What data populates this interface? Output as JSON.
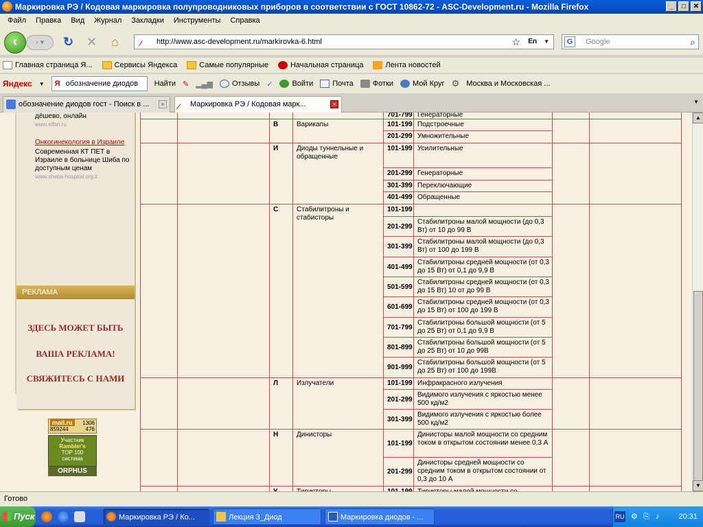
{
  "window": {
    "title": "Маркировка РЭ / Кодовая маркировка полупроводниковых приборов в соответствии с ГОСТ 10862-72 - ASC-Development.ru - Mozilla Firefox"
  },
  "menu": [
    "Файл",
    "Правка",
    "Вид",
    "Журнал",
    "Закладки",
    "Инструменты",
    "Справка"
  ],
  "address": {
    "url": "http://www.asc-development.ru/markirovka-6.html",
    "lang": "En"
  },
  "search": {
    "placeholder": "Google"
  },
  "bookmarks": [
    "Главная страница Я...",
    "Сервисы Яндекса",
    "Самые популярные",
    "Начальная страница",
    "Лента новостей"
  ],
  "yandex_bar": {
    "logo": "Яндекс",
    "query": "обозначение диодов",
    "find": "Найти",
    "reviews": "Отзывы",
    "login": "Войти",
    "mail": "Почта",
    "photos": "Фотки",
    "mycircle": "Мой Круг",
    "region": "Москва и Московская ..."
  },
  "tabs": [
    {
      "label": "обозначение диодов гост - Поиск в ...",
      "active": false
    },
    {
      "label": "Маркировка РЭ / Кодовая марк...",
      "active": true
    }
  ],
  "sidebar": {
    "ad1_line1": "дёшево, онлайн",
    "ad1_src": "www.elfan.ru",
    "ad2_link": "Онкогинекология в Израиле",
    "ad2_text": "Современная КТ ПЕТ в Израиле в больнице Шиба по доступным ценам",
    "ad2_src": "www.sheba-hospital.org.il",
    "ad_header": "РЕКЛАМА",
    "ad_line1": "ЗДЕСЬ МОЖЕТ БЫТЬ",
    "ad_line2": "ВАША РЕКЛАМА!",
    "ad_line3": "СВЯЖИТЕСЬ С НАМИ",
    "counter_mail": "mail.ru",
    "counter_n1": "1306",
    "counter_n2": "859244",
    "counter_n3": "476",
    "rambler_1": "Участник",
    "rambler_2": "Rambler's",
    "rambler_3": "TOP 100",
    "rambler_4": "система",
    "orphus": "ORPHUS"
  },
  "table": {
    "rows": [
      {
        "code": "",
        "type": "",
        "range": "701-799",
        "desc": "Генераторные"
      },
      {
        "code": "В",
        "type": "Варикапы",
        "range": "101-199",
        "desc": "Подстроечные"
      },
      {
        "code": "",
        "type": "",
        "range": "201-299",
        "desc": "Умножительные"
      },
      {
        "code": "И",
        "type": "Диоды туннельные и обращенные",
        "range": "101-199",
        "desc": "Усилительные"
      },
      {
        "code": "",
        "type": "",
        "range": "201-299",
        "desc": "Генераторные"
      },
      {
        "code": "",
        "type": "",
        "range": "301-399",
        "desc": "Переключающие"
      },
      {
        "code": "",
        "type": "",
        "range": "401-499",
        "desc": "Обращенные"
      },
      {
        "code": "С",
        "type": "Стабилитроны и стабисторы",
        "range": "101-199",
        "desc": ""
      },
      {
        "code": "",
        "type": "",
        "range": "201-299",
        "desc": "Стабилитроны малой мощности (до 0,3 Вт) от 10 до 99 В"
      },
      {
        "code": "",
        "type": "",
        "range": "301-399",
        "desc": "Стабилитроны малой мощности (до 0,3 Вт) от 100 до 199 В"
      },
      {
        "code": "",
        "type": "",
        "range": "401-499",
        "desc": "Стабилитроны средней мощности (от 0,3 до 15 Вт) от 0,1 до 9,9 В"
      },
      {
        "code": "",
        "type": "",
        "range": "501-599",
        "desc": "Стабилитроны средней мощности (от 0,3 до 15 Вт) 10 от до 99 В"
      },
      {
        "code": "",
        "type": "",
        "range": "601-699",
        "desc": "Стабилитроны средней мощности (от 0,3 до 15 Вт) от 100 до 199 В"
      },
      {
        "code": "",
        "type": "",
        "range": "701-799",
        "desc": "Стабилитроны большой мощности (от 5 до 25 Вт) от 0,1 до 9,9 В"
      },
      {
        "code": "",
        "type": "",
        "range": "801-899",
        "desc": "Стабилитроны большой мощности (от 5 до 25 Вт) от 10 до 99В"
      },
      {
        "code": "",
        "type": "",
        "range": "901-999",
        "desc": "Стабилитроны большой мощности (от 5 до 25 Вт) от 100 до 199В"
      },
      {
        "code": "Л",
        "type": "Излучатели",
        "range": "101-199",
        "desc": "Инфракрасного излучения"
      },
      {
        "code": "",
        "type": "",
        "range": "201-299",
        "desc": "Видимого излучения с яркостью менее 500 кд/м2"
      },
      {
        "code": "",
        "type": "",
        "range": "301-399",
        "desc": "Видимого излучения с яркостью более 500 кд/м2"
      },
      {
        "code": "Н",
        "type": "Динисторы",
        "range": "101-199",
        "desc": "Динисторы малой мощности со средним током в открытом состоянии менее 0,3 А"
      },
      {
        "code": "",
        "type": "",
        "range": "201-299",
        "desc": "Динисторы средней мощности со средним током в открытом состоянии от 0,3 до 10 А"
      },
      {
        "code": "У",
        "type": "Тиристоры",
        "range": "101-199",
        "desc": "Тиристоры малой мощности со"
      }
    ]
  },
  "status": "Готово",
  "taskbar": {
    "start": "Пуск",
    "tasks": [
      "Маркировка РЭ / Ко...",
      "Лекция 3_Диод",
      "Маркировка диодов - ..."
    ],
    "lang": "RU",
    "clock": "20:31"
  }
}
